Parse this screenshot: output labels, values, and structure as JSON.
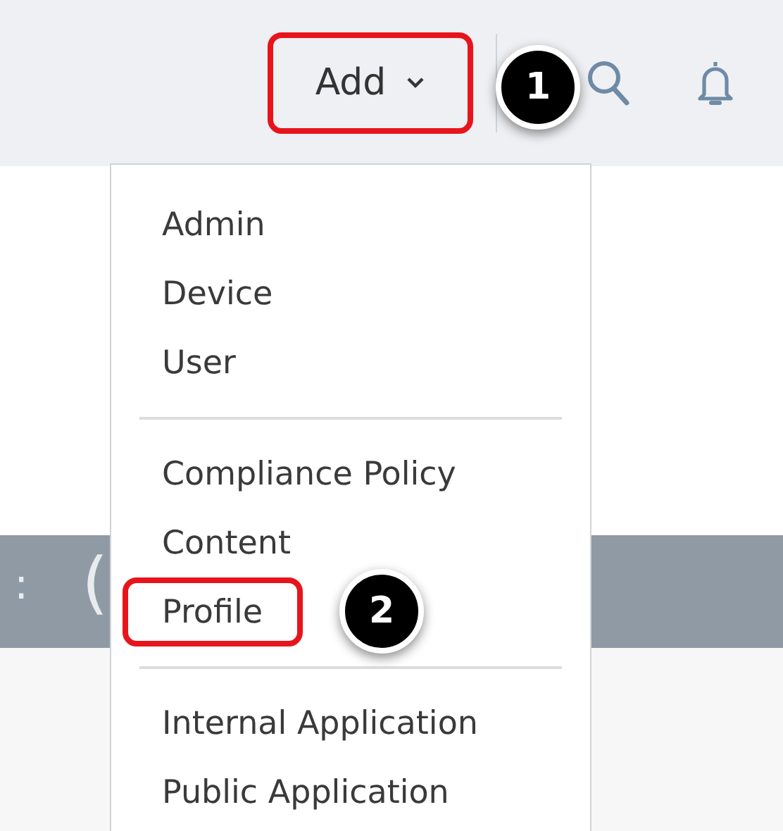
{
  "topbar": {
    "add_button": {
      "label": "Add",
      "highlighted": true
    },
    "callout": "1"
  },
  "background_band": {
    "texts": [
      ":",
      "("
    ]
  },
  "add_menu": {
    "groups": [
      {
        "items": [
          {
            "label": "Admin",
            "highlighted": false
          },
          {
            "label": "Device",
            "highlighted": false
          },
          {
            "label": "User",
            "highlighted": false
          }
        ]
      },
      {
        "items": [
          {
            "label": "Compliance Policy",
            "highlighted": false
          },
          {
            "label": "Content",
            "highlighted": false
          },
          {
            "label": "Profile",
            "highlighted": true,
            "callout": "2"
          }
        ]
      },
      {
        "items": [
          {
            "label": "Internal Application",
            "highlighted": false
          },
          {
            "label": "Public Application",
            "highlighted": false
          }
        ]
      }
    ]
  }
}
